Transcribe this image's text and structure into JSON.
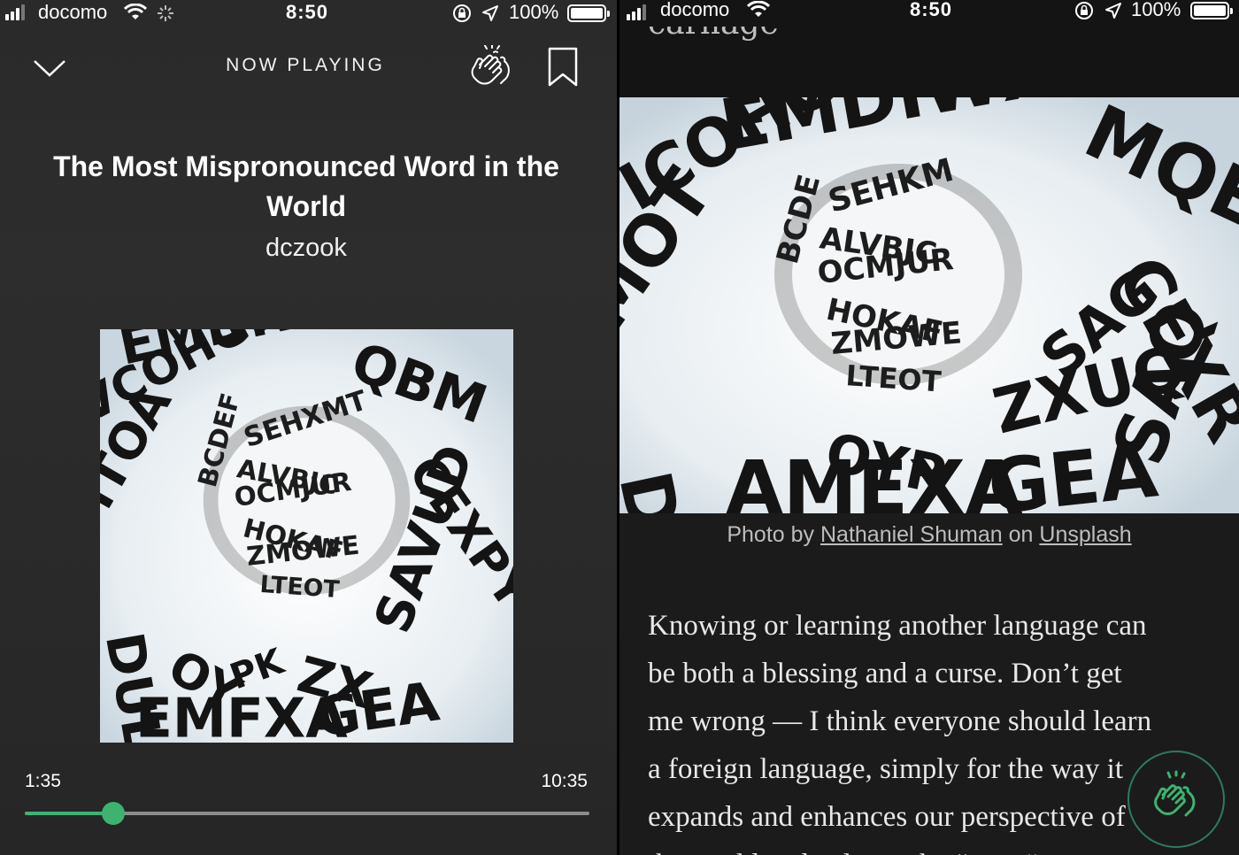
{
  "left_panel": {
    "status": {
      "carrier": "docomo",
      "time": "8:50",
      "battery": "100%"
    },
    "header": {
      "label": "NOW PLAYING"
    },
    "track": {
      "title": "The Most Mispronounced Word in the World",
      "author": "dczook",
      "elapsed": "1:35",
      "total": "10:35",
      "progress": 0.156
    }
  },
  "right_panel": {
    "status": {
      "carrier": "docomo",
      "time": "8:50",
      "battery": "100%"
    },
    "prev_word": "carnage",
    "caption": {
      "prefix": "Photo by",
      "photographer": "Nathaniel Shuman",
      "middle": "on",
      "site": "Unsplash"
    },
    "body_lines": [
      "Knowing or learning another language can",
      "be both a blessing and a curse. Don’t get",
      "me wrong — I think everyone should learn",
      "a foreign language, simply for the way it",
      "expands and enhances our perspective of",
      "the world and culture, the “extra”"
    ]
  },
  "colors": {
    "accent": "#3cb371",
    "clap_ring": "#2f7a5b"
  },
  "icons": [
    "chevron-down-icon",
    "clap-icon",
    "bookmark-icon",
    "wifi-icon",
    "signal-icon",
    "battery-icon",
    "location-icon",
    "rotation-lock-icon"
  ]
}
